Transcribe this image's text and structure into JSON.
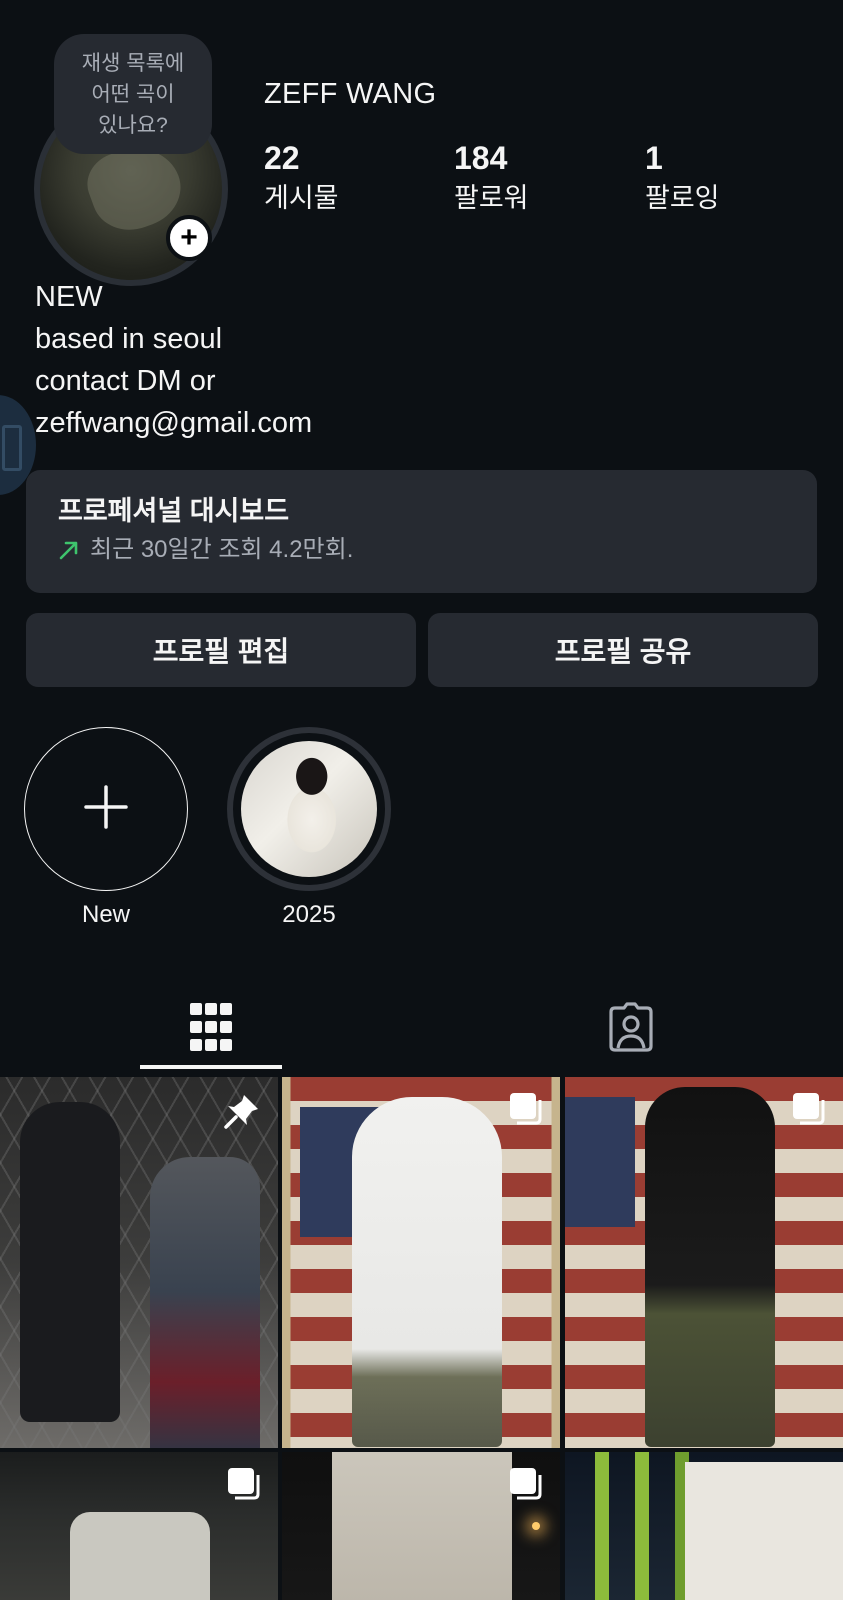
{
  "note": {
    "text": "재생 목록에\n어떤 곡이\n있나요?"
  },
  "profile": {
    "username": "ZEFF WANG",
    "stats": [
      {
        "value": "22",
        "label": "게시물"
      },
      {
        "value": "184",
        "label": "팔로워"
      },
      {
        "value": "1",
        "label": "팔로잉"
      }
    ],
    "bio": [
      "NEW",
      "based in seoul",
      "contact DM or",
      "zeffwang@gmail.com"
    ]
  },
  "dashboard": {
    "title": "프로페셔널 대시보드",
    "subtitle": "최근 30일간 조회 4.2만회.",
    "trend_color": "#3ec46d"
  },
  "actions": {
    "edit_profile": "프로필 편집",
    "share_profile": "프로필 공유"
  },
  "highlights": [
    {
      "label": "New",
      "icon": "plus-icon"
    },
    {
      "label": "2025",
      "icon": "highlight-cover"
    }
  ],
  "tabs": [
    {
      "name": "posts-grid",
      "icon": "grid-icon",
      "active": true
    },
    {
      "name": "tagged",
      "icon": "tagged-person-icon",
      "active": false
    }
  ],
  "grid": {
    "posts": [
      {
        "badge": "pin-icon"
      },
      {
        "badge": "carousel-icon"
      },
      {
        "badge": "carousel-icon"
      },
      {
        "badge": "carousel-icon"
      },
      {
        "badge": "carousel-icon"
      },
      {
        "badge": "carousel-icon"
      }
    ]
  },
  "colors": {
    "background": "#0c1014",
    "surface": "#262a31",
    "text": "#f5f5f5",
    "muted": "#a8adb6"
  }
}
